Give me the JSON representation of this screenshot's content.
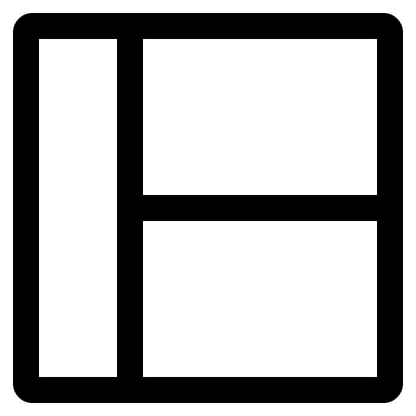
{
  "icon": {
    "name": "layout-sidebar-split-icon",
    "stroke_color": "#000000",
    "fill_color": "#ffffff",
    "panels": [
      "sidebar-panel",
      "top-right-panel",
      "bottom-right-panel"
    ]
  }
}
